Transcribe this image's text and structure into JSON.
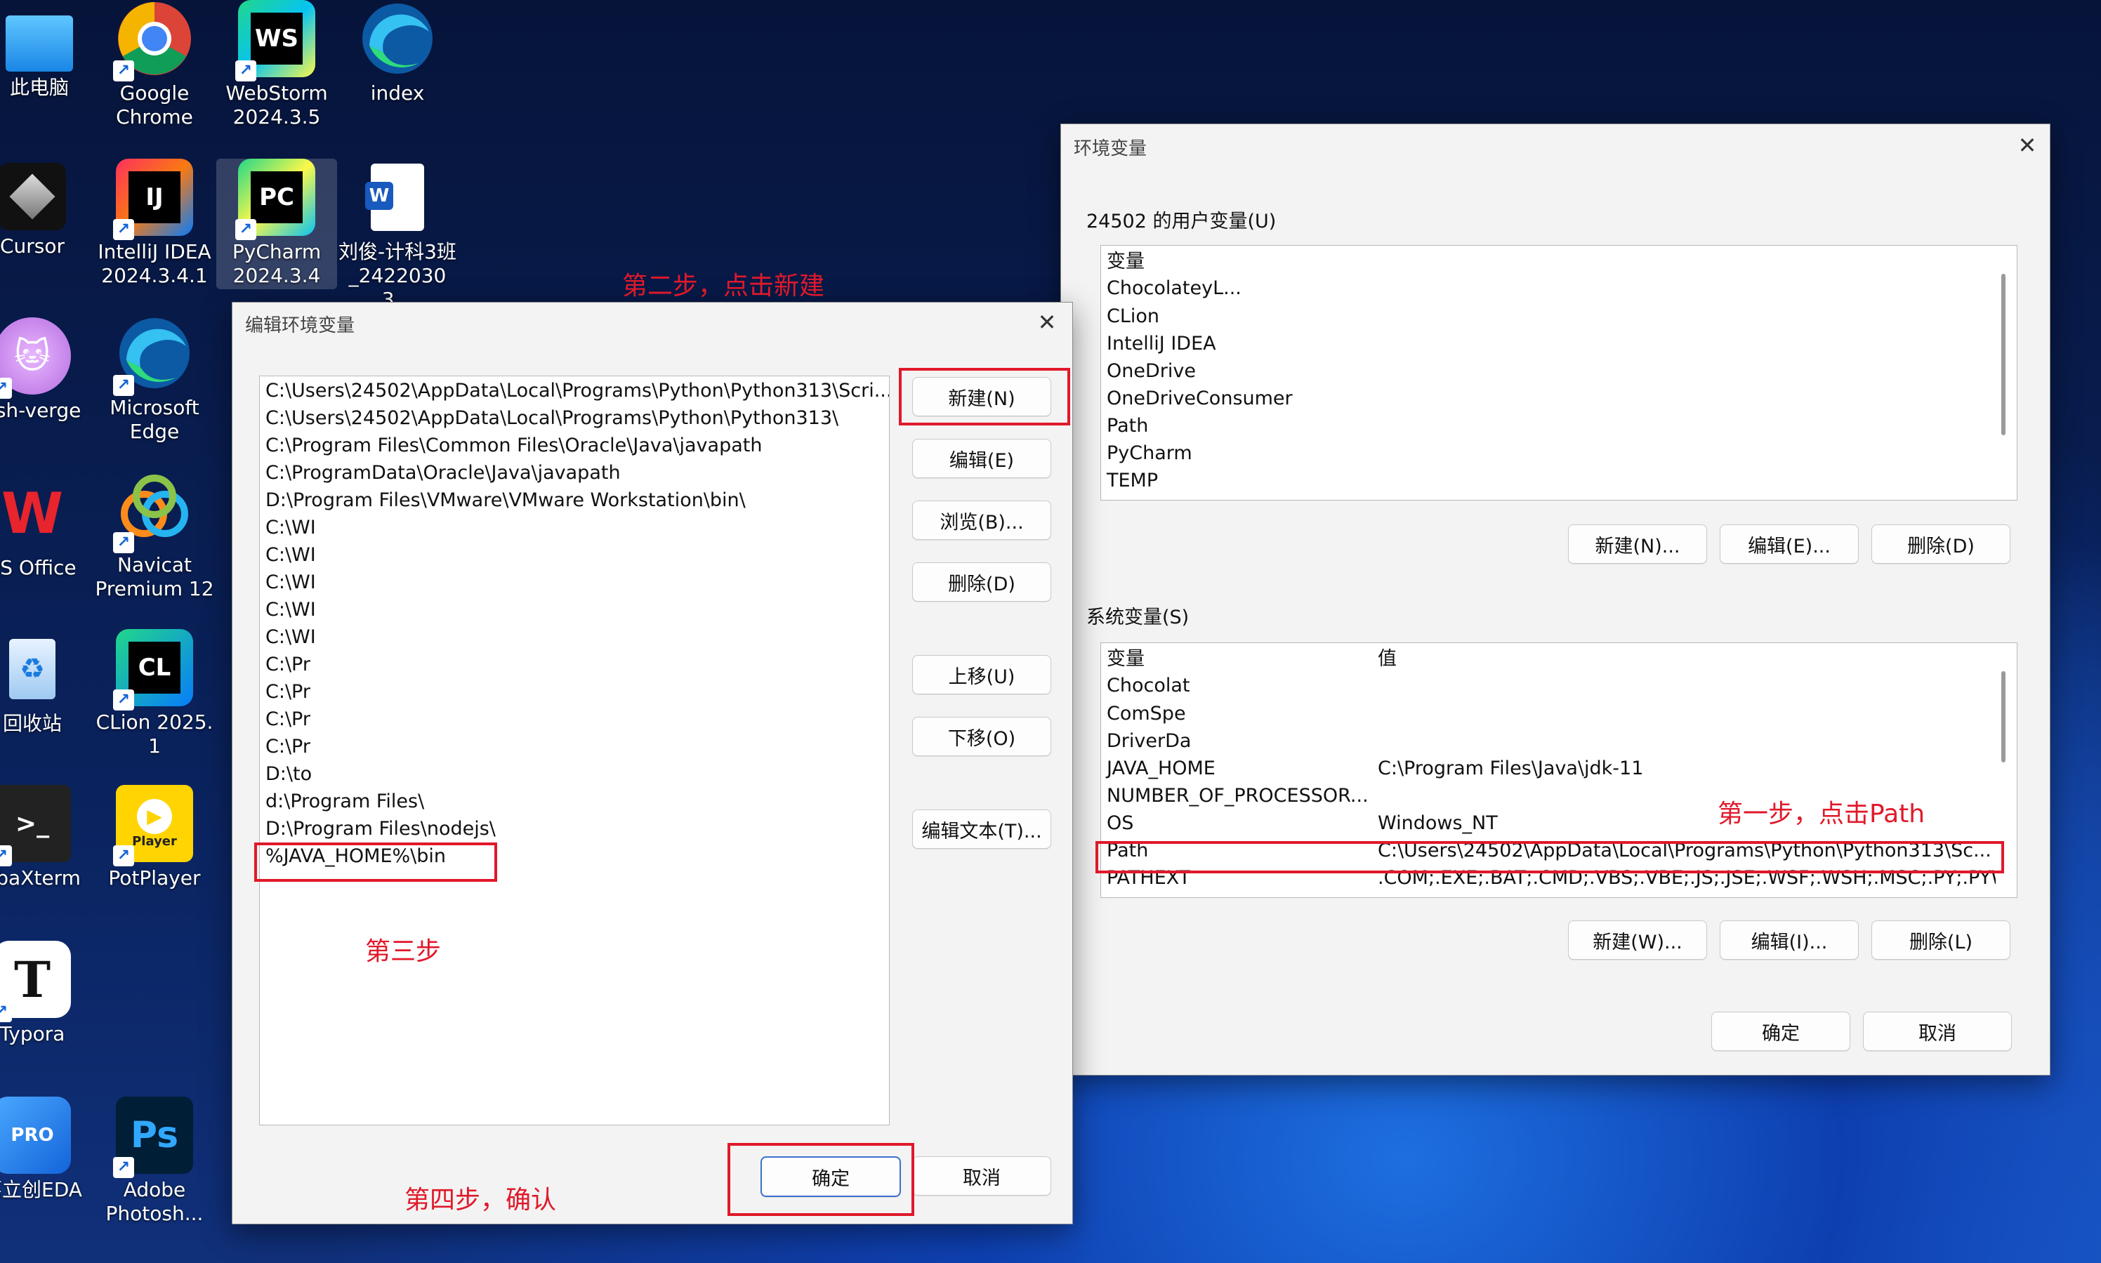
{
  "desktop_icons": [
    {
      "label": "此电脑",
      "icon": "monitor-icon"
    },
    {
      "label": "Google\nChrome",
      "icon": "chrome-icon"
    },
    {
      "label": "WebStorm\n2024.3.5",
      "icon": "webstorm-icon",
      "mark": "WS"
    },
    {
      "label": "index",
      "icon": "edge-icon"
    },
    {
      "label": "Cursor",
      "icon": "cursor-icon"
    },
    {
      "label": "IntelliJ IDEA\n2024.3.4.1",
      "icon": "intellij-icon",
      "mark": "IJ"
    },
    {
      "label": "PyCharm\n2024.3.4",
      "icon": "pycharm-icon",
      "mark": "PC"
    },
    {
      "label": "刘俊-计科3班\n_24220303...",
      "icon": "word-doc-icon",
      "mark": "W"
    },
    {
      "label": "ash-verge",
      "icon": "clash-verge-icon"
    },
    {
      "label": "Microsoft\nEdge",
      "icon": "edge-icon"
    },
    {
      "label": "PS Office",
      "icon": "wps-office-icon",
      "mark": "W"
    },
    {
      "label": "Navicat\nPremium 12",
      "icon": "navicat-icon"
    },
    {
      "label": "回收站",
      "icon": "recycle-bin-icon"
    },
    {
      "label": "CLion 2025.1",
      "icon": "clion-icon",
      "mark": "CL"
    },
    {
      "label": "obaXterm",
      "icon": "mobaxterm-icon"
    },
    {
      "label": "PotPlayer",
      "icon": "potplayer-icon",
      "mark": "Player"
    },
    {
      "label": "Typora",
      "icon": "typora-icon",
      "mark": "T"
    },
    {
      "label": "嘉立创EDA",
      "icon": "jlc-eda-icon",
      "mark": "PRO"
    },
    {
      "label": "Adobe\nPhotosh...",
      "icon": "photoshop-icon",
      "mark": "Ps"
    }
  ],
  "env_window": {
    "title": "环境变量",
    "user_group_label": "24502 的用户变量(U)",
    "user_header": "变量",
    "user_vars": [
      "ChocolateyL...",
      "CLion",
      "IntelliJ IDEA",
      "OneDrive",
      "OneDriveConsumer",
      "Path",
      "PyCharm",
      "TEMP"
    ],
    "user_buttons": [
      "新建(N)...",
      "编辑(E)...",
      "删除(D)"
    ],
    "sys_group_label": "系统变量(S)",
    "sys_header_var": "变量",
    "sys_header_val": "值",
    "sys_vars": [
      {
        "name": "Chocolat",
        "value": ""
      },
      {
        "name": "ComSpe",
        "value": ""
      },
      {
        "name": "DriverDa",
        "value": ""
      },
      {
        "name": "JAVA_HOME",
        "value": "C:\\Program Files\\Java\\jdk-11"
      },
      {
        "name": "NUMBER_OF_PROCESSOR...",
        "value": ""
      },
      {
        "name": "OS",
        "value": "Windows_NT"
      },
      {
        "name": "Path",
        "value": "C:\\Users\\24502\\AppData\\Local\\Programs\\Python\\Python313\\Sc..."
      },
      {
        "name": "PATHEXT",
        "value": ".COM;.EXE;.BAT;.CMD;.VBS;.VBE;.JS;.JSE;.WSF;.WSH;.MSC;.PY;.PYW"
      }
    ],
    "sys_buttons": [
      "新建(W)...",
      "编辑(I)...",
      "删除(L)"
    ],
    "ok": "确定",
    "cancel": "取消"
  },
  "edit_window": {
    "title": "编辑环境变量",
    "entries": [
      "C:\\Users\\24502\\AppData\\Local\\Programs\\Python\\Python313\\Scri...",
      "C:\\Users\\24502\\AppData\\Local\\Programs\\Python\\Python313\\",
      "C:\\Program Files\\Common Files\\Oracle\\Java\\javapath",
      "C:\\ProgramData\\Oracle\\Java\\javapath",
      "D:\\Program Files\\VMware\\VMware Workstation\\bin\\",
      "C:\\WI",
      "C:\\WI",
      "C:\\WI",
      "C:\\WI",
      "C:\\WI",
      "C:\\Pr",
      "C:\\Pr",
      "C:\\Pr",
      "C:\\Pr",
      "D:\\to",
      "d:\\Program Files\\",
      "D:\\Program Files\\nodejs\\",
      "%JAVA_HOME%\\bin"
    ],
    "buttons": [
      "新建(N)",
      "编辑(E)",
      "浏览(B)...",
      "删除(D)",
      "上移(U)",
      "下移(O)",
      "编辑文本(T)..."
    ],
    "ok": "确定",
    "cancel": "取消"
  },
  "annotations": {
    "step1": "第一步，点击Path",
    "step2": "第二步，点击新建",
    "step3": "第三步",
    "step4": "第四步，确认"
  },
  "colors": {
    "annotation_red": "#e0192a",
    "accent_blue": "#3c6fd0"
  }
}
